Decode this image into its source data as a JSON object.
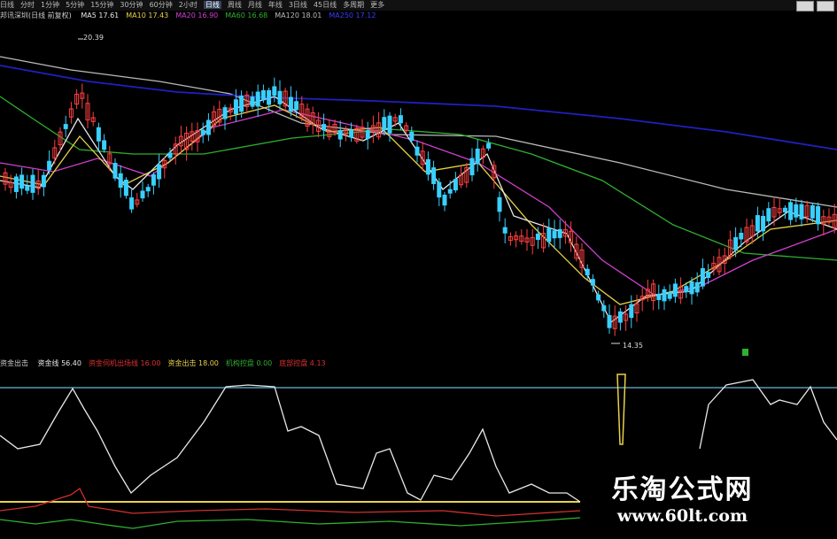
{
  "periods": [
    "日线",
    "分时",
    "1分钟",
    "5分钟",
    "15分钟",
    "30分钟",
    "60分钟",
    "2小时",
    "日线",
    "周线",
    "月线",
    "年线",
    "3日线",
    "45日线",
    "多周期",
    "更多"
  ],
  "active_period_index": 8,
  "main_legend": {
    "title": "邦讯深圳(日线 前复权)",
    "items": [
      {
        "label": "MA5 17.61",
        "color": "#e8e8e8"
      },
      {
        "label": "MA10 17.43",
        "color": "#e8d24a"
      },
      {
        "label": "MA20 16.90",
        "color": "#d040d0"
      },
      {
        "label": "MA60 16.68",
        "color": "#2fb02f"
      },
      {
        "label": "MA120 18.01",
        "color": "#bbbbbb"
      },
      {
        "label": "MA250 17.12",
        "color": "#3a3aff"
      }
    ]
  },
  "price_labels": {
    "high": "20.39",
    "low": "14.35"
  },
  "sub_legend": {
    "title": "资金出击",
    "items": [
      {
        "label": "资金线 56.40",
        "color": "#e8e8e8"
      },
      {
        "label": "资金伺机出场线 16.00",
        "color": "#e03030"
      },
      {
        "label": "资金出击 18.00",
        "color": "#e8d24a"
      },
      {
        "label": "机构控盘 0.00",
        "color": "#2fb02f"
      },
      {
        "label": "底部控盘 4.13",
        "color": "#e03030"
      }
    ]
  },
  "watermark": {
    "title": "乐淘公式网",
    "url": "www.60lt.com"
  },
  "colors": {
    "up": "#ff4040",
    "down": "#39d0ff",
    "ma5": "#e8e8e8",
    "ma10": "#e8d24a",
    "ma20": "#d040d0",
    "ma60": "#2fb02f",
    "ma120": "#bbbbbb",
    "ma250": "#2020c0",
    "cyan_line": "#6fb6d8",
    "yellow_line": "#e8d24a"
  }
}
